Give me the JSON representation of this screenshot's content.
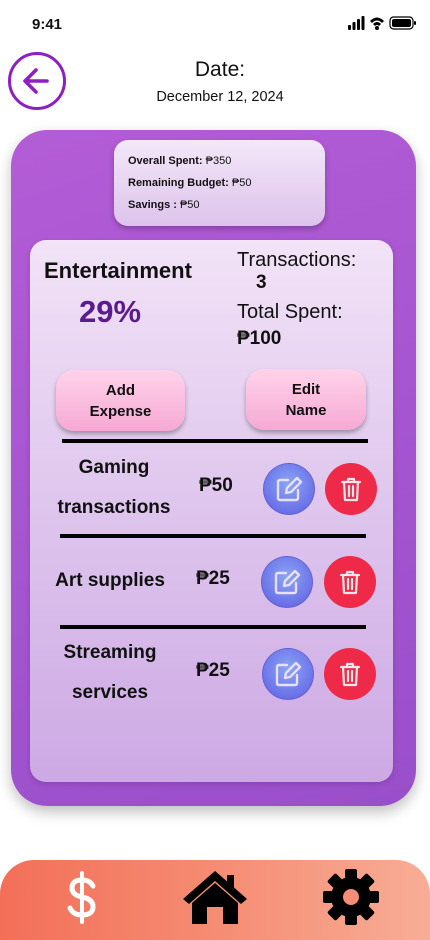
{
  "status": {
    "time": "9:41"
  },
  "header": {
    "date_label": "Date:",
    "date_value": "December 12, 2024"
  },
  "summary": {
    "overall_label": "Overall Spent:",
    "overall_value": " ₱350",
    "remaining_label": "Remaining Budget:",
    "remaining_value": " ₱50",
    "savings_label": "Savings :",
    "savings_value": " ₱50"
  },
  "category": {
    "name": "Entertainment",
    "percent": "29%",
    "transactions_label": "Transactions:",
    "transactions_count": "3",
    "total_label": "Total Spent:",
    "total_value": "₱100"
  },
  "buttons": {
    "add_expense": "Add\nExpense",
    "edit_name": "Edit\nName"
  },
  "transactions": [
    {
      "name": "Gaming\ntransactions",
      "amount": "₱50"
    },
    {
      "name": "Art supplies",
      "amount": "₱25"
    },
    {
      "name": "Streaming\nservices",
      "amount": "₱25"
    }
  ],
  "colors": {
    "accent_purple": "#8e1fc0",
    "card_purple": "#a354cf",
    "delete_red": "#ee2a48",
    "edit_blue": "#6b72e8",
    "nav_gradient_start": "#f36f58",
    "nav_gradient_end": "#f8ad96"
  },
  "icons": {
    "back": "arrow-left-icon",
    "edit": "pencil-square-icon",
    "delete": "trash-icon",
    "nav": [
      "dollar-icon",
      "home-icon",
      "gear-icon"
    ]
  }
}
